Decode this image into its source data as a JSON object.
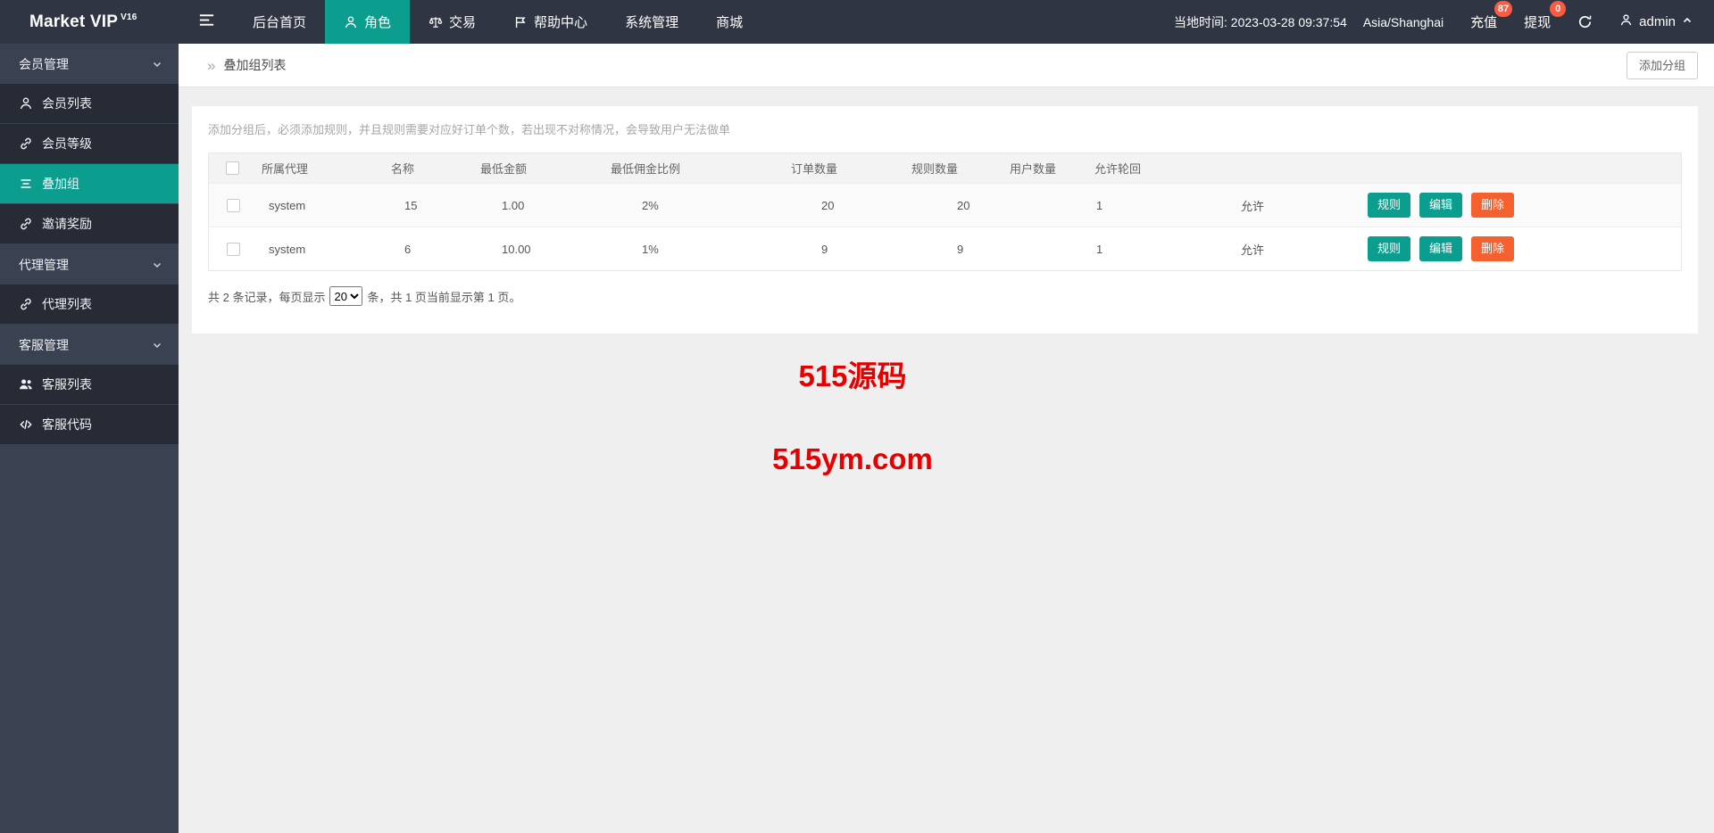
{
  "brand": {
    "name": "Market VIP",
    "version": "V16"
  },
  "topnav": {
    "items": [
      {
        "label": "后台首页",
        "icon": null,
        "active": false
      },
      {
        "label": "角色",
        "icon": "person",
        "active": true
      },
      {
        "label": "交易",
        "icon": "scales",
        "active": false
      },
      {
        "label": "帮助中心",
        "icon": "flag",
        "active": false
      },
      {
        "label": "系统管理",
        "icon": null,
        "active": false
      },
      {
        "label": "商城",
        "icon": null,
        "active": false
      }
    ],
    "local_time": "当地时间: 2023-03-28 09:37:54",
    "timezone": "Asia/Shanghai",
    "recharge": {
      "label": "充值",
      "badge": "87"
    },
    "withdraw": {
      "label": "提现",
      "badge": "0"
    },
    "user": {
      "name": "admin"
    }
  },
  "sidebar": {
    "groups": [
      {
        "label": "会员管理",
        "items": [
          {
            "label": "会员列表",
            "icon": "person",
            "active": false
          },
          {
            "label": "会员等级",
            "icon": "link",
            "active": false
          },
          {
            "label": "叠加组",
            "icon": "list",
            "active": true
          },
          {
            "label": "邀请奖励",
            "icon": "link",
            "active": false
          }
        ]
      },
      {
        "label": "代理管理",
        "items": [
          {
            "label": "代理列表",
            "icon": "link",
            "active": false
          }
        ]
      },
      {
        "label": "客服管理",
        "items": [
          {
            "label": "客服列表",
            "icon": "people",
            "active": false
          },
          {
            "label": "客服代码",
            "icon": "code",
            "active": false
          }
        ]
      }
    ]
  },
  "breadcrumb": {
    "title": "叠加组列表"
  },
  "toolbar": {
    "add_group_label": "添加分组"
  },
  "notice": "添加分组后，必须添加规则，并且规则需要对应好订单个数，若出现不对称情况，会导致用户无法做单",
  "table": {
    "columns": [
      "所属代理",
      "名称",
      "最低金额",
      "最低佣金比例",
      "订单数量",
      "规则数量",
      "用户数量",
      "允许轮回"
    ],
    "rows": [
      {
        "agent": "system",
        "name": "15",
        "min_amount": "1.00",
        "min_commission": "2%",
        "orders": "20",
        "rules": "20",
        "users": "1",
        "recycle": "允许"
      },
      {
        "agent": "system",
        "name": "6",
        "min_amount": "10.00",
        "min_commission": "1%",
        "orders": "9",
        "rules": "9",
        "users": "1",
        "recycle": "允许"
      }
    ],
    "actions": {
      "rule": "规则",
      "edit": "编辑",
      "delete": "删除"
    }
  },
  "pagination": {
    "prefix": "共 2 条记录，每页显示",
    "page_size": "20",
    "suffix": "条，共 1 页当前显示第 1 页。"
  },
  "watermark": {
    "line1": "515源码",
    "line2": "515ym.com"
  },
  "colors": {
    "navbar": "#2f3542",
    "sidebar": "#3a4150",
    "accent": "#0b9d8d",
    "danger": "#f4612e",
    "badge": "#fc5b3f",
    "watermark": "#e60000"
  }
}
